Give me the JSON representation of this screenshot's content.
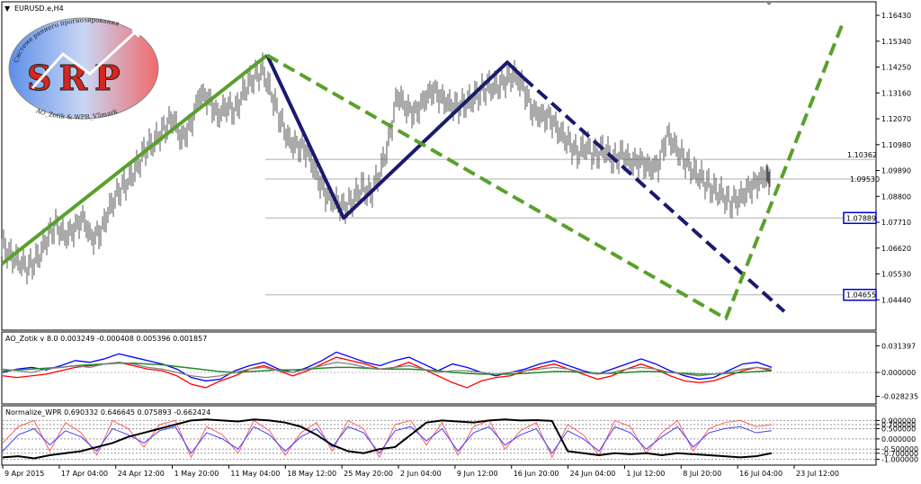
{
  "window": {
    "symbol_label": "EURUSD.e,H4"
  },
  "logo": {
    "big_text": "SRP",
    "arc_text_top": "Система раннего прогнозирования",
    "arc_text_bottom": "AO_Zotik & WPR_V5mark"
  },
  "colors": {
    "price_bars": "#555555",
    "wave_green": "#5aa02c",
    "wave_navy": "#1a1a6e",
    "level_line": "#b0b0b0",
    "ao_blue": "#0000ff",
    "ao_red": "#ff0000",
    "ao_green": "#228b22",
    "ao_gray": "#808080",
    "ao_dark": "#800000",
    "wpr_black": "#000000",
    "wpr_red": "#ff6060",
    "wpr_blue": "#4040ff",
    "box_border": "#0000cc"
  },
  "chart_data": [
    {
      "type": "line",
      "title": "EURUSD.e,H4",
      "ylim": [
        1.0335,
        1.1685
      ],
      "y_ticks": [
        "1.16430",
        "1.15340",
        "1.14250",
        "1.13160",
        "1.12070",
        "1.10980",
        "1.09890",
        "1.08800",
        "1.07710",
        "1.06620",
        "1.05530",
        "1.04440"
      ],
      "x_ticks": [
        "9 Apr 2015",
        "17 Apr 04:00",
        "24 Apr 12:00",
        "1 May 20:00",
        "11 May 04:00",
        "18 May 12:00",
        "25 May 20:00",
        "2 Jun 04:00",
        "9 Jun 12:00",
        "16 Jun 20:00",
        "24 Jun 04:00",
        "1 Jul 12:00",
        "8 Jul 20:00",
        "16 Jul 04:00",
        "23 Jul 12:00"
      ],
      "series": [
        {
          "x": [
            0,
            10,
            20,
            30,
            40,
            50,
            60,
            70,
            80,
            90,
            100,
            110,
            120,
            130,
            140,
            150,
            160,
            170,
            180,
            190,
            200,
            210,
            220,
            230,
            240,
            250,
            260,
            270,
            280,
            290,
            300,
            310,
            320,
            330,
            340,
            350,
            360,
            370,
            380,
            390,
            400,
            410,
            420,
            430,
            440,
            450,
            460,
            470,
            480,
            490,
            500,
            510,
            520,
            530,
            540,
            550,
            560,
            570,
            580,
            590,
            600,
            610,
            620,
            630,
            640,
            650,
            660,
            670,
            680,
            690,
            700,
            710,
            720,
            730,
            740,
            750,
            760,
            770,
            780,
            790,
            800,
            810,
            820,
            830,
            840,
            850,
            855
          ],
          "values": [
            1.068,
            1.063,
            1.06,
            1.058,
            1.062,
            1.07,
            1.076,
            1.071,
            1.074,
            1.079,
            1.07,
            1.073,
            1.083,
            1.09,
            1.094,
            1.1,
            1.108,
            1.111,
            1.116,
            1.121,
            1.112,
            1.118,
            1.131,
            1.129,
            1.122,
            1.126,
            1.124,
            1.133,
            1.138,
            1.141,
            1.131,
            1.12,
            1.111,
            1.109,
            1.107,
            1.097,
            1.089,
            1.086,
            1.083,
            1.086,
            1.092,
            1.089,
            1.097,
            1.111,
            1.131,
            1.125,
            1.123,
            1.129,
            1.133,
            1.129,
            1.126,
            1.126,
            1.128,
            1.131,
            1.134,
            1.134,
            1.137,
            1.139,
            1.134,
            1.124,
            1.122,
            1.121,
            1.115,
            1.111,
            1.106,
            1.109,
            1.105,
            1.108,
            1.103,
            1.106,
            1.102,
            1.103,
            1.1,
            1.101,
            1.114,
            1.108,
            1.103,
            1.098,
            1.095,
            1.091,
            1.089,
            1.085,
            1.087,
            1.091,
            1.094,
            1.097,
            1.095
          ]
        }
      ],
      "hlines": [
        {
          "value": 1.1036,
          "label": "1.10362"
        },
        {
          "value": 1.0953,
          "label": "1.09530"
        },
        {
          "value": 1.0789,
          "label": "1.07889"
        },
        {
          "value": 1.0465,
          "label": "1.04655"
        }
      ],
      "waves": [
        {
          "style": "solid",
          "color": "green",
          "points": [
            [
              0,
              1.0595
            ],
            [
              295,
              1.1475
            ]
          ]
        },
        {
          "style": "solid",
          "color": "navy",
          "points": [
            [
              295,
              1.1475
            ],
            [
              380,
              1.0789
            ],
            [
              562,
              1.1445
            ],
            [
              580,
              1.138
            ]
          ]
        },
        {
          "style": "dashed",
          "color": "navy",
          "points": [
            [
              580,
              1.138
            ],
            [
              870,
              1.0395
            ]
          ]
        },
        {
          "style": "dashed",
          "color": "green",
          "points": [
            [
              295,
              1.1475
            ],
            [
              805,
              1.0365
            ],
            [
              935,
              1.161
            ]
          ]
        }
      ]
    },
    {
      "type": "line",
      "title": "AO_Zotik v 8.0 0.003249 -0.000408 0.005396 0.001857",
      "ylim": [
        -0.034,
        0.034
      ],
      "y_ticks": [
        "0.031397",
        "0.000000",
        "-0.028235"
      ],
      "series": [
        {
          "name": "AO_Zotik v 8.0",
          "values": [
            0.0,
            0.004,
            0.006,
            0.003,
            0.008,
            0.014,
            0.012,
            0.016,
            0.022,
            0.018,
            0.014,
            0.01,
            0.004,
            -0.006,
            -0.01,
            -0.008,
            0.002,
            0.008,
            0.012,
            0.004,
            0.0,
            0.006,
            0.014,
            0.024,
            0.018,
            0.012,
            0.008,
            0.014,
            0.018,
            0.01,
            0.002,
            0.01,
            0.006,
            0.0,
            -0.004,
            0.0,
            0.004,
            0.01,
            0.014,
            0.008,
            0.002,
            -0.002,
            0.004,
            0.01,
            0.016,
            0.01,
            0.002,
            -0.004,
            -0.008,
            -0.006,
            0.002,
            0.01,
            0.012,
            0.006
          ]
        },
        {
          "name": "",
          "values": [
            -0.004,
            -0.006,
            -0.004,
            -0.002,
            0.002,
            0.006,
            0.008,
            0.01,
            0.012,
            0.008,
            0.004,
            0.002,
            -0.004,
            -0.014,
            -0.018,
            -0.01,
            -0.004,
            0.004,
            0.008,
            0.002,
            -0.004,
            0.002,
            0.01,
            0.018,
            0.014,
            0.01,
            0.004,
            0.006,
            0.012,
            0.004,
            -0.004,
            -0.012,
            -0.018,
            -0.01,
            -0.006,
            -0.004,
            0.002,
            0.006,
            0.01,
            0.004,
            -0.002,
            -0.008,
            -0.004,
            0.004,
            0.01,
            0.004,
            -0.004,
            -0.01,
            -0.012,
            -0.01,
            -0.004,
            0.002,
            0.006,
            0.002
          ]
        },
        {
          "name": "",
          "values": [
            0.002,
            0.003,
            0.004,
            0.005,
            0.006,
            0.008,
            0.009,
            0.01,
            0.011,
            0.011,
            0.01,
            0.009,
            0.007,
            0.005,
            0.003,
            0.001,
            0.0,
            0.001,
            0.002,
            0.003,
            0.003,
            0.004,
            0.005,
            0.006,
            0.006,
            0.005,
            0.004,
            0.004,
            0.004,
            0.003,
            0.002,
            0.0,
            -0.001,
            -0.002,
            -0.002,
            -0.002,
            -0.001,
            0.0,
            0.001,
            0.001,
            0.0,
            -0.001,
            -0.001,
            0.0,
            0.001,
            0.001,
            0.0,
            -0.001,
            -0.002,
            -0.002,
            -0.001,
            0.0,
            0.001,
            0.002
          ]
        },
        {
          "name": "",
          "values": [
            0.004,
            0.002,
            0.0,
            0.004,
            0.006,
            0.008,
            0.006,
            0.01,
            0.012,
            0.01,
            0.006,
            0.004,
            0.0,
            -0.004,
            -0.006,
            -0.004,
            0.0,
            0.004,
            0.006,
            0.002,
            0.0,
            0.004,
            0.008,
            0.012,
            0.01,
            0.006,
            0.004,
            0.006,
            0.008,
            0.004,
            0.0,
            0.002,
            0.002,
            0.0,
            -0.002,
            0.0,
            0.002,
            0.004,
            0.006,
            0.004,
            0.0,
            -0.002,
            0.0,
            0.004,
            0.006,
            0.004,
            0.0,
            -0.002,
            -0.004,
            -0.002,
            0.0,
            0.004,
            0.006,
            0.004
          ]
        }
      ]
    },
    {
      "type": "line",
      "title": "Normalize_WPR 0.690332 0.646645 0.075893 -0.662424",
      "ylim": [
        -1.15,
        1.05
      ],
      "y_ticks": [
        "0.900000",
        "0.700000",
        "0.500000",
        "0.000000",
        "-0.500000",
        "-0.700000",
        "-1.000000"
      ],
      "series": [
        {
          "name": "Normalize_WPR",
          "values": [
            -0.9,
            -0.85,
            -0.95,
            -0.8,
            -0.7,
            -0.6,
            -0.4,
            -0.2,
            0.1,
            0.3,
            0.5,
            0.7,
            0.9,
            0.95,
            0.9,
            0.85,
            0.95,
            0.9,
            0.8,
            0.6,
            0.2,
            -0.3,
            -0.6,
            -0.7,
            -0.5,
            -0.4,
            0.2,
            0.8,
            0.9,
            0.85,
            0.8,
            0.9,
            0.95,
            0.9,
            0.92,
            0.88,
            -0.6,
            -0.7,
            -0.8,
            -0.7,
            -0.75,
            -0.7,
            -0.8,
            -0.7,
            -0.75,
            -0.8,
            -0.85,
            -0.9,
            -0.85,
            -0.7
          ]
        },
        {
          "name": "",
          "values": [
            -0.2,
            0.6,
            0.9,
            -0.6,
            0.8,
            0.3,
            -0.8,
            0.9,
            0.5,
            -0.4,
            0.7,
            0.9,
            -0.9,
            0.6,
            0.2,
            -0.7,
            0.9,
            0.4,
            -0.8,
            0.3,
            0.8,
            -0.6,
            0.9,
            0.5,
            -0.9,
            0.7,
            0.9,
            -0.3,
            0.8,
            -0.8,
            0.6,
            0.9,
            -0.5,
            0.4,
            0.8,
            -0.9,
            0.7,
            0.2,
            -0.8,
            0.9,
            0.6,
            -0.7,
            0.3,
            0.9,
            -0.6,
            0.5,
            0.8,
            0.9,
            0.6,
            0.7
          ]
        },
        {
          "name": "",
          "values": [
            -0.6,
            0.2,
            0.5,
            -0.3,
            0.4,
            0.1,
            -0.6,
            0.5,
            0.2,
            -0.2,
            0.4,
            0.6,
            -0.7,
            0.3,
            0.0,
            -0.5,
            0.6,
            0.2,
            -0.6,
            0.1,
            0.5,
            -0.4,
            0.6,
            0.3,
            -0.7,
            0.4,
            0.6,
            -0.1,
            0.5,
            -0.6,
            0.3,
            0.6,
            -0.3,
            0.2,
            0.5,
            -0.7,
            0.4,
            0.0,
            -0.6,
            0.6,
            0.3,
            -0.5,
            0.1,
            0.6,
            -0.4,
            0.3,
            0.5,
            0.6,
            0.3,
            0.4
          ]
        }
      ]
    }
  ]
}
